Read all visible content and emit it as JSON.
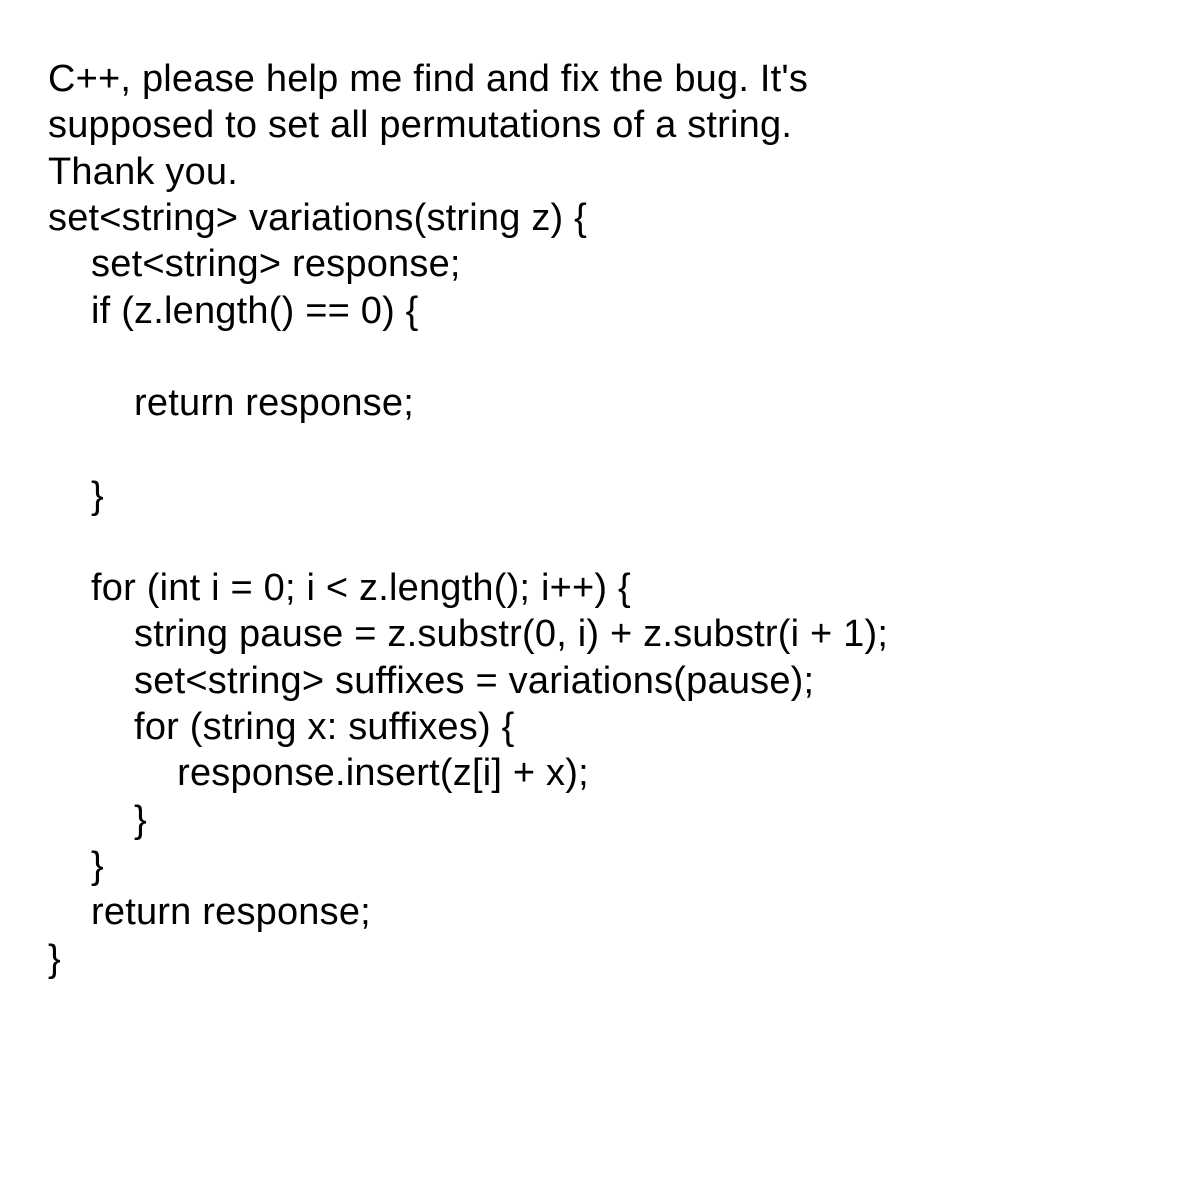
{
  "lines": [
    "C++, please help me find and fix the bug. It's",
    "supposed to set all permutations of a string.",
    "Thank you.",
    "set<string> variations(string z) {",
    "    set<string> response;",
    "    if (z.length() == 0) {",
    "",
    "        return response;",
    "",
    "    }",
    "",
    "    for (int i = 0; i < z.length(); i++) {",
    "        string pause = z.substr(0, i) + z.substr(i + 1);",
    "        set<string> suffixes = variations(pause);",
    "        for (string x: suffixes) {",
    "            response.insert(z[i] + x);",
    "        }",
    "    }",
    "    return response;",
    "}"
  ]
}
